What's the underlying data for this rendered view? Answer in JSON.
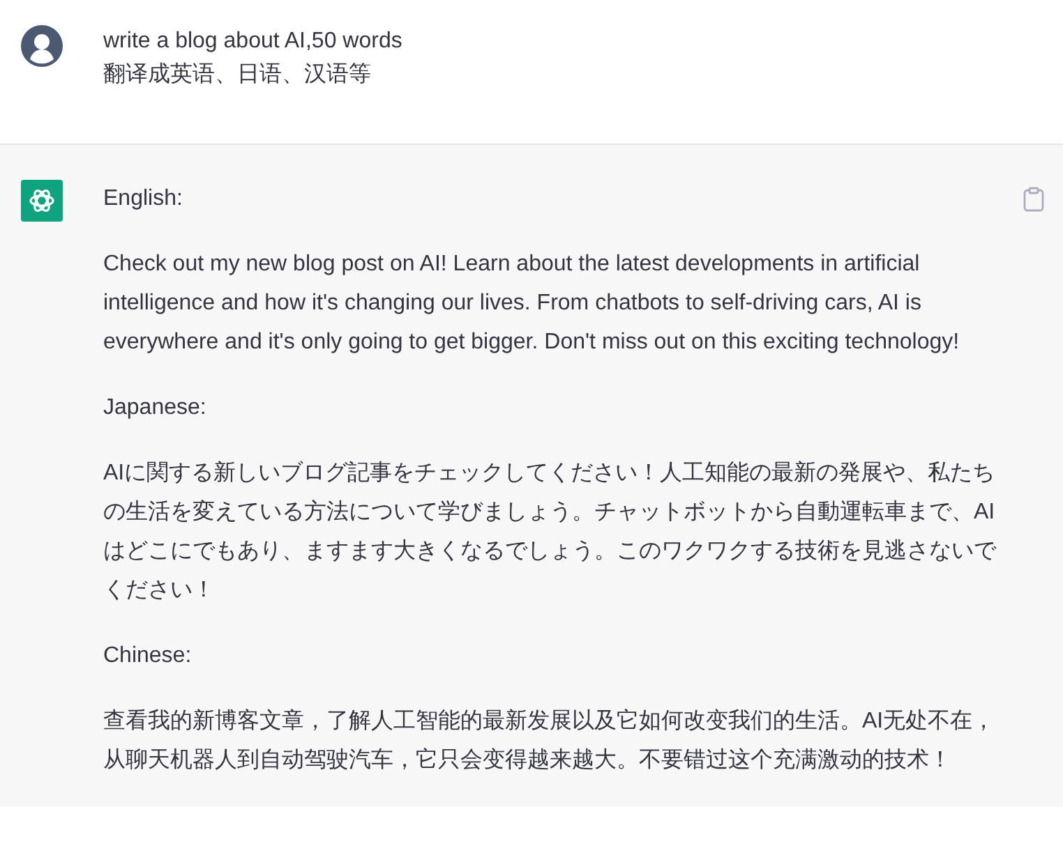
{
  "messages": [
    {
      "kind": "user",
      "lines": [
        "write a blog about AI,50 words",
        "翻译成英语、日语、汉语等"
      ]
    },
    {
      "kind": "assistant",
      "lines": [
        "English:",
        "Check out my new blog post on AI! Learn about the latest developments in artificial intelligence and how it's changing our lives. From chatbots to self-driving cars, AI is everywhere and it's only going to get bigger. Don't miss out on this exciting technology!",
        "Japanese:",
        "AIに関する新しいブログ記事をチェックしてください！人工知能の最新の発展や、私たちの生活を変えている方法について学びましょう。チャットボットから自動運転車まで、AIはどこにでもあり、ますます大きくなるでしょう。このワクワクする技術を見逃さないでください！",
        "Chinese:",
        "查看我的新博客文章，了解人工智能的最新发展以及它如何改变我们的生活。AI无处不在，从聊天机器人到自动驾驶汽车，它只会变得越来越大。不要错过这个充满激动的技术！"
      ]
    }
  ]
}
